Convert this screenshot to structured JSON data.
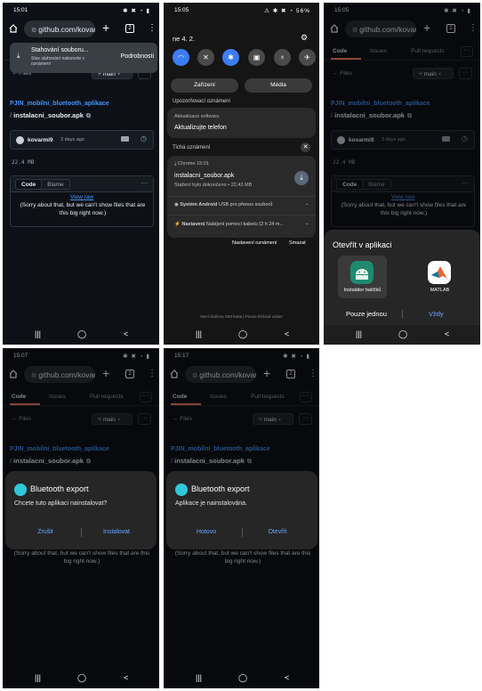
{
  "common": {
    "url": "github.com/kovar",
    "tab_count": "2",
    "tabs": [
      "Code",
      "Issues",
      "Pull requests"
    ],
    "more": "···",
    "files_back": "← Files",
    "branch": "main",
    "repo_name": "PJIN_mobilni_bluetooth_aplikace",
    "file_name": "instalacni_soubor.apk",
    "commit_user": "kovarmi9",
    "commit_time": "3 days ago",
    "file_size": "22.4 MB",
    "view_code": "Code",
    "view_blame": "Blame",
    "view_raw": "View raw",
    "too_big": "(Sorry about that, but we can't show files that are this big right now.)",
    "nav": [
      "|||",
      "◯",
      "<"
    ]
  },
  "panel1": {
    "time": "15:01",
    "toast_title": "Stahování souboru...",
    "toast_sub": "Stav stahování naleznete v oznámení",
    "toast_action": "Podrobnosti"
  },
  "panel2": {
    "time": "15:05",
    "battery": "56%",
    "date": "ne 4. 2.",
    "pill_devices": "Zařízení",
    "pill_media": "Média",
    "section_alert": "Upozorňovací oznámení",
    "update_app": "Aktualizace softwaru",
    "update_text": "Aktualizujte telefon",
    "section_silent": "Tichá oznámení",
    "chrome_app": "Chrome",
    "chrome_time": "15:01",
    "dl_file": "instalacni_soubor.apk",
    "dl_status": "Stažení bylo dokončeno • 22,43 MB",
    "sys_app": "Systém Android",
    "sys_text": "USB pro přenos souborů",
    "set_app": "Nastavení",
    "set_text": "Nabíjení pomocí kabelu (2 h 24 m...",
    "btn_settings": "Nastavení oznámení",
    "btn_clear": "Smazat",
    "no_sim": "Není vložena SIM karta | Pouze tísňová volání"
  },
  "panel3": {
    "time": "15:05",
    "title": "Otevřít v aplikaci",
    "app1": "Instalátor balíčků",
    "app2": "MATLAB",
    "once": "Pouze jednou",
    "always": "Vždy"
  },
  "panel4": {
    "time": "15:07",
    "title": "Bluetooth export",
    "msg": "Chcete tuto aplikaci nainstalovat?",
    "btn_left": "Zrušit",
    "btn_right": "Instalovat"
  },
  "panel5": {
    "time": "15:17",
    "title": "Bluetooth export",
    "msg": "Aplikace je nainstalována.",
    "btn_left": "Hotovo",
    "btn_right": "Otevřít"
  },
  "colors": {
    "bg": "#0d1117",
    "link": "#4493f8",
    "accent_tab": "#f78166",
    "dialog_button": "#6aa6ff",
    "qs_on": "#3d7df2"
  }
}
